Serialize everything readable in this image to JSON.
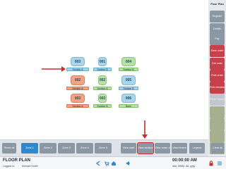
{
  "tables": [
    {
      "number": "003",
      "section": "Section A",
      "color": "blue"
    },
    {
      "number": "001",
      "section": "Section B",
      "color": "blue"
    },
    {
      "number": "004",
      "section": "Section B",
      "color": "green"
    },
    {
      "number": "002",
      "section": "Section A",
      "color": "orange"
    },
    {
      "number": "002",
      "section": "Section A",
      "color": "green"
    },
    {
      "number": "005",
      "section": "Section B",
      "color": "blue"
    },
    {
      "number": "003",
      "section": "Section A",
      "color": "orange"
    },
    {
      "number": "003",
      "section": "Section B",
      "color": "green"
    },
    {
      "number": "006",
      "section": "None",
      "color": "blue"
    }
  ],
  "sidebar": {
    "title": "Floor Plan",
    "buttons": [
      {
        "label": "Register",
        "style": "gray"
      },
      {
        "label": "Details",
        "style": "gray"
      },
      {
        "label": "Pay",
        "style": "gray"
      },
      {
        "label": "Save order",
        "style": "red"
      },
      {
        "label": "Get order",
        "style": "red"
      },
      {
        "label": "Print order",
        "style": "red"
      },
      {
        "label": "Print minutes",
        "style": "red"
      },
      {
        "label": "Final Tickets",
        "style": "light"
      },
      {
        "label": "",
        "style": "olive"
      },
      {
        "label": "",
        "style": "olive"
      },
      {
        "label": "",
        "style": "olive"
      },
      {
        "label": "",
        "style": "olive"
      }
    ]
  },
  "toolbar": {
    "reset_all": "Reset all",
    "zones": [
      "Zone 1",
      "Zone 2",
      "Zone 3",
      "Zone 4",
      "Zone 5"
    ],
    "active_zone": "Zone 1",
    "view_staff": "View staff",
    "view_section": "View section",
    "view_order": "View order #",
    "view_timers": "View timers",
    "legend": "Legend",
    "clear_all": "Clear all"
  },
  "status": {
    "title": "FLOOR PLAN",
    "logged_in_label": "Logged In:",
    "user": "Michael Smith",
    "time": "00:00:00 AM",
    "date": "ddd, MMM. dd, yyyy"
  },
  "colors": {
    "active_zone": "#2f88cc",
    "red_button": "#c8414a",
    "arrow": "#d12a2a"
  },
  "icons": [
    "back-icon",
    "cart-icon",
    "home-icon",
    "share-icon",
    "lock-icon",
    "menu-icon"
  ]
}
